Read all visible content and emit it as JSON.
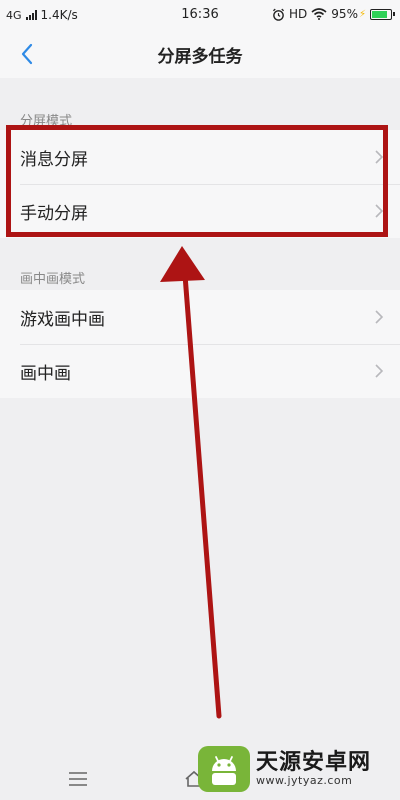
{
  "status_bar": {
    "network": "4G",
    "speed": "1.4K/s",
    "time": "16:36",
    "hd": "HD",
    "battery_percent": "95%",
    "battery_level": 0.95,
    "battery_color": "#2fd158"
  },
  "header": {
    "title": "分屏多任务",
    "back_icon": "chevron-left-icon",
    "accent_color": "#2e8ae6"
  },
  "sections": [
    {
      "label": "分屏模式",
      "items": [
        {
          "label": "消息分屏"
        },
        {
          "label": "手动分屏"
        }
      ]
    },
    {
      "label": "画中画模式",
      "items": [
        {
          "label": "游戏画中画"
        },
        {
          "label": "画中画"
        }
      ]
    }
  ],
  "annotation": {
    "color": "#ad1414"
  },
  "nav_bar": {
    "icons": [
      "menu-icon",
      "home-icon"
    ]
  },
  "watermark": {
    "title": "天源安卓网",
    "url": "www.jytyaz.com"
  }
}
